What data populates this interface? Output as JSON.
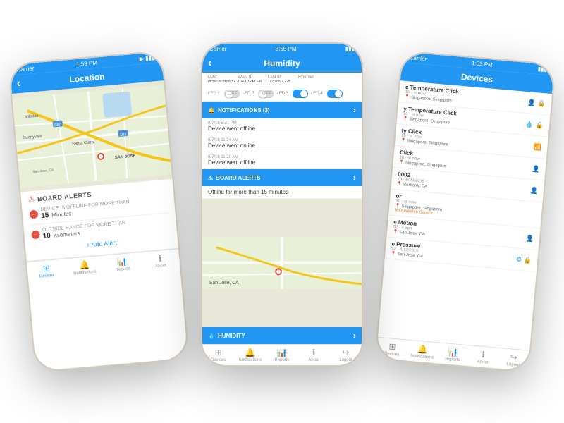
{
  "scene": {
    "background": "#f8f8f8"
  },
  "phone_left": {
    "status_bar": {
      "carrier": "Carrier",
      "time": "1:59 PM",
      "signal": "▶"
    },
    "nav": {
      "title": "Location",
      "back": "‹"
    },
    "board_alerts": {
      "title": "BOARD ALERTS",
      "alert1": {
        "prefix": "DEVICE IS OFFLINE FOR MORE THAN",
        "value": "15",
        "unit": "Minutes"
      },
      "alert2": {
        "prefix": "OUTSIDE RANGE FOR MORE THAN",
        "value": "10",
        "unit": "Kilometers"
      },
      "add_button": "+ Add Alert"
    },
    "tabs": [
      {
        "icon": "⊞",
        "label": "Devices",
        "active": true
      },
      {
        "icon": "🔔",
        "label": "Notifications",
        "active": false
      },
      {
        "icon": "📊",
        "label": "Reports",
        "active": false
      },
      {
        "icon": "ℹ",
        "label": "About",
        "active": false
      }
    ]
  },
  "phone_center": {
    "status_bar": {
      "carrier": "Carrier",
      "time": "3:55 PM"
    },
    "nav": {
      "title": "Humidity",
      "back": "‹"
    },
    "info": {
      "mac_label": "MAC",
      "mac_val": "d8:80:39:8f:d6:52",
      "wan_label": "WAN IP",
      "wan_val": "104.10.248.245",
      "lan_label": "LAN IP",
      "lan_val": "192.168.7.228",
      "eth_label": "Ethernet",
      "eth_val": ""
    },
    "leds": {
      "led1_label": "LED 1",
      "led1_state": "off",
      "led2_label": "LED 2",
      "led2_state": "off",
      "led3_label": "LED 3",
      "led3_state": "on",
      "led4_label": "LED 4",
      "led4_state": "on"
    },
    "notifications": {
      "header": "NOTIFICATIONS (3)",
      "items": [
        {
          "time": "6/7/16 5:31 PM",
          "text": "Device went offline"
        },
        {
          "time": "6/7/16 11:24 AM",
          "text": "Device went online"
        },
        {
          "time": "6/7/16 11:20 AM",
          "text": "Device went offline"
        }
      ]
    },
    "board_alerts": {
      "header": "BOARD ALERTS",
      "text": "Offline for more than 15 minutes"
    },
    "humidity_section": {
      "header": "HUMIDITY"
    },
    "tabs": [
      {
        "icon": "⊞",
        "label": "Devices",
        "active": false
      },
      {
        "icon": "🔔",
        "label": "Notifications",
        "active": false
      },
      {
        "icon": "📊",
        "label": "Reports",
        "active": false
      },
      {
        "icon": "ℹ",
        "label": "About",
        "active": false
      },
      {
        "icon": "↪",
        "label": "Logout",
        "active": false
      }
    ]
  },
  "phone_right": {
    "status_bar": {
      "carrier": "Carrier",
      "time": "1:53 PM"
    },
    "nav": {
      "title": "Devices"
    },
    "devices": [
      {
        "name": "e Temperature Click",
        "meta1": "16",
        "meta2": "st now",
        "location": "Singapore, Singapore",
        "icons": [
          "person",
          "lock"
        ]
      },
      {
        "name": "y Temperature Click",
        "meta1": "16",
        "meta2": "st now",
        "location": "Singapore, Singapore",
        "icons": [
          "droplet",
          "lock"
        ]
      },
      {
        "name": "ty Click",
        "meta1": "16",
        "meta2": "st now",
        "location": "Singapore, Singapore",
        "icons": [
          "wifi"
        ]
      },
      {
        "name": "Click",
        "meta1": "16",
        "meta2": "st now",
        "location": "Singapore, Singapore",
        "icons": [
          "person"
        ]
      },
      {
        "name": "0002",
        "meta1": "76",
        "meta2": "5/20/2016",
        "location": "Burbank, CA",
        "icons": [
          "person"
        ]
      },
      {
        "name": "or",
        "meta1": "52",
        "meta2": "st now",
        "location": "Singapore, Singapore",
        "no_sensor": "No Available Sensor"
      },
      {
        "name": "e Motion",
        "meta1": "52",
        "meta2": "s ago",
        "location": "San Jose, CA",
        "icons": [
          "person"
        ]
      },
      {
        "name": "e Pressure",
        "meta1": "52",
        "meta2": "4/12/2016",
        "location": "San Jose, CA",
        "icons": [
          "gear",
          "lock"
        ]
      }
    ],
    "tabs": [
      {
        "icon": "⊞",
        "label": "Devices",
        "active": false
      },
      {
        "icon": "🔔",
        "label": "Notifications",
        "active": false
      },
      {
        "icon": "📊",
        "label": "Reports",
        "active": false
      },
      {
        "icon": "ℹ",
        "label": "About",
        "active": false
      },
      {
        "icon": "↪",
        "label": "Logout",
        "active": false
      }
    ]
  }
}
